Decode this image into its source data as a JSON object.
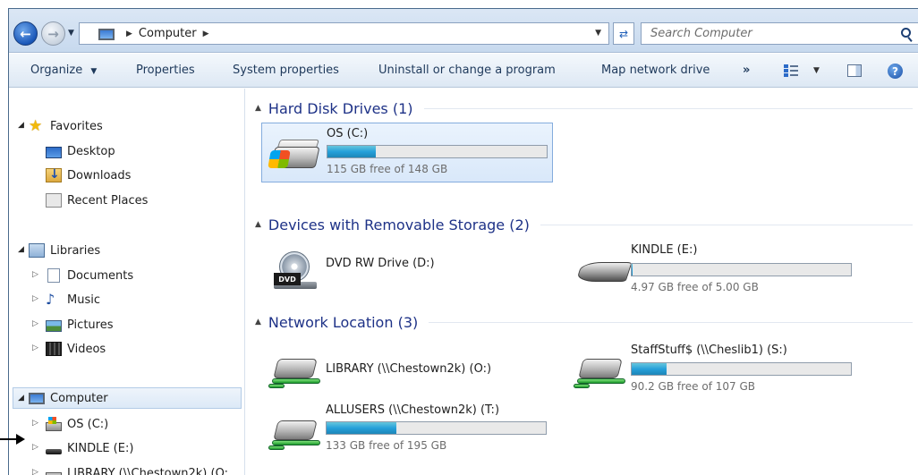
{
  "address_bar": {
    "breadcrumb": [
      "Computer"
    ],
    "search_placeholder": "Search Computer"
  },
  "toolbar": {
    "organize": "Organize",
    "properties": "Properties",
    "system_properties": "System properties",
    "uninstall": "Uninstall or change a program",
    "map_network_drive": "Map network drive",
    "more": "»"
  },
  "nav": {
    "favorites": {
      "label": "Favorites",
      "items": [
        {
          "label": "Desktop",
          "icon": "desktop-icon"
        },
        {
          "label": "Downloads",
          "icon": "downloads-folder-icon"
        },
        {
          "label": "Recent Places",
          "icon": "recent-places-icon"
        }
      ]
    },
    "libraries": {
      "label": "Libraries",
      "items": [
        {
          "label": "Documents",
          "icon": "documents-icon"
        },
        {
          "label": "Music",
          "icon": "music-icon"
        },
        {
          "label": "Pictures",
          "icon": "pictures-icon"
        },
        {
          "label": "Videos",
          "icon": "videos-icon"
        }
      ]
    },
    "computer": {
      "label": "Computer",
      "items": [
        {
          "label": "OS (C:)",
          "icon": "os-drive-icon"
        },
        {
          "label": "KINDLE (E:)",
          "icon": "kindle-drive-icon"
        },
        {
          "label": "LIBRARY (\\\\Chestown2k) (O:",
          "icon": "network-drive-icon"
        }
      ]
    }
  },
  "groups": {
    "hard_disk": {
      "title": "Hard Disk Drives (1)",
      "drives": [
        {
          "name": "OS (C:)",
          "free_text": "115 GB free of 148 GB",
          "used_fraction": 0.22
        }
      ]
    },
    "removable": {
      "title": "Devices with Removable Storage (2)",
      "drives": [
        {
          "name": "DVD RW Drive (D:)"
        },
        {
          "name": "KINDLE (E:)",
          "free_text": "4.97 GB free of 5.00 GB",
          "used_fraction": 0.006
        }
      ]
    },
    "network": {
      "title": "Network Location (3)",
      "drives": [
        {
          "name": "LIBRARY (\\\\Chestown2k) (O:)"
        },
        {
          "name": "StaffStuff$ (\\\\Cheslib1) (S:)",
          "free_text": "90.2 GB free of 107 GB",
          "used_fraction": 0.16
        },
        {
          "name": "ALLUSERS (\\\\Chestown2k) (T:)",
          "free_text": "133 GB free of 195 GB",
          "used_fraction": 0.32
        }
      ]
    }
  },
  "dvd_label": "DVD",
  "colors": {
    "group_title": "#1e3287",
    "bar_fill": "#26a0da",
    "selection": "#84acdd"
  }
}
